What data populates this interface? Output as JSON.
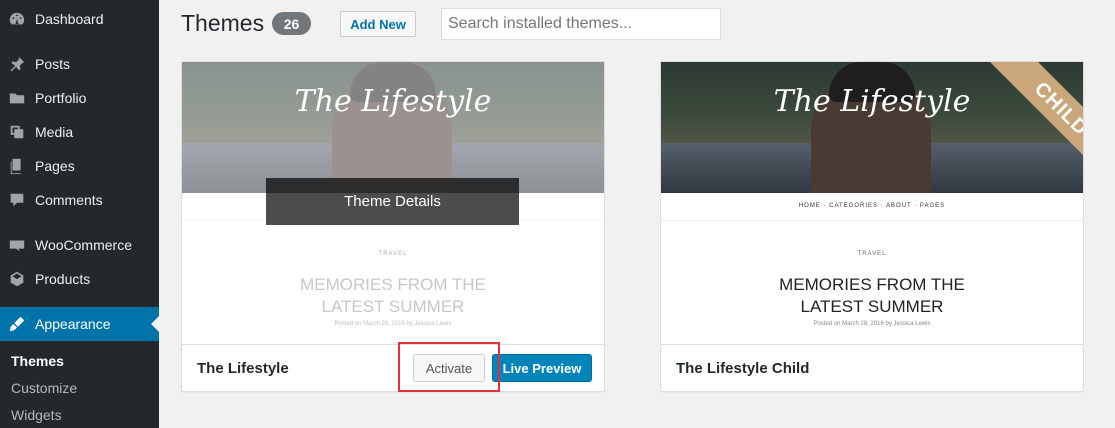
{
  "sidebar": {
    "items": [
      {
        "label": "Dashboard",
        "icon": "dashboard-icon"
      },
      {
        "label": "Posts",
        "icon": "pin-icon"
      },
      {
        "label": "Portfolio",
        "icon": "folder-icon"
      },
      {
        "label": "Media",
        "icon": "media-icon"
      },
      {
        "label": "Pages",
        "icon": "pages-icon"
      },
      {
        "label": "Comments",
        "icon": "comment-icon"
      },
      {
        "label": "WooCommerce",
        "icon": "woocommerce-icon"
      },
      {
        "label": "Products",
        "icon": "box-icon"
      },
      {
        "label": "Appearance",
        "icon": "brush-icon"
      }
    ],
    "submenu": [
      "Themes",
      "Customize",
      "Widgets"
    ],
    "active_submenu": "Themes"
  },
  "header": {
    "title": "Themes",
    "count": "26",
    "add_new": "Add New",
    "search_placeholder": "Search installed themes..."
  },
  "themes": [
    {
      "name": "The Lifestyle",
      "screenshot_logo": "The Lifestyle",
      "post_category": "TRAVEL",
      "post_title": "MEMORIES FROM THE LATEST SUMMER",
      "post_meta": "Posted on March 28, 2016 by Jessica Lewis",
      "overlay": "Theme Details",
      "activate": "Activate",
      "live_preview": "Live Preview"
    },
    {
      "name": "The Lifestyle Child",
      "screenshot_logo": "The Lifestyle",
      "nav": "HOME · CATEGORIES · ABOUT · PAGES",
      "post_category": "TRAVEL",
      "post_title": "MEMORIES FROM THE LATEST SUMMER",
      "post_meta": "Posted on March 28, 2016 by Jessica Lewis",
      "ribbon": "CHILD"
    }
  ],
  "colors": {
    "sidebar_bg": "#23282d",
    "accent": "#0073aa",
    "primary_button": "#0085ba",
    "highlight": "#e0323a",
    "child_ribbon": "#c9a77a"
  }
}
